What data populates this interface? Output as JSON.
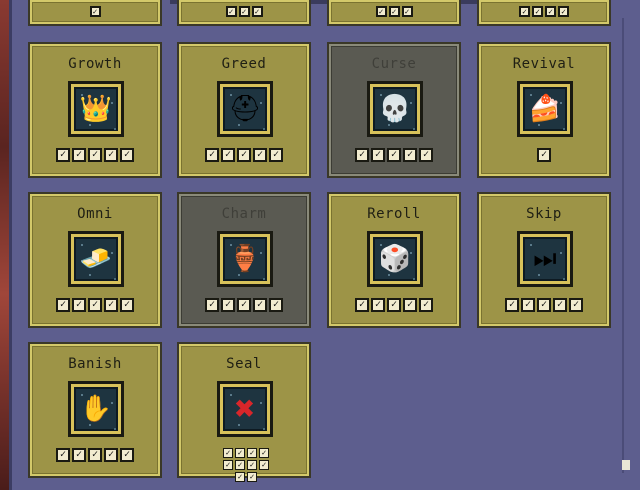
{
  "top_row": [
    {
      "checks": 1
    },
    {
      "checks": 3
    },
    {
      "checks": 3
    },
    {
      "checks": 4
    }
  ],
  "cards": [
    {
      "title": "Growth",
      "icon": "crown-icon",
      "glyph": "👑",
      "checks": 5,
      "dim": false
    },
    {
      "title": "Greed",
      "icon": "helmet-icon",
      "glyph": "⛑",
      "checks": 5,
      "dim": false
    },
    {
      "title": "Curse",
      "icon": "skull-icon",
      "glyph": "💀",
      "checks": 5,
      "dim": true
    },
    {
      "title": "Revival",
      "icon": "cake-icon",
      "glyph": "🍰",
      "checks": 1,
      "dim": false
    },
    {
      "title": "Omni",
      "icon": "gold-bar-icon",
      "glyph": "🧈",
      "checks": 5,
      "dim": false
    },
    {
      "title": "Charm",
      "icon": "potion-icon",
      "glyph": "🏺",
      "checks": 5,
      "dim": true
    },
    {
      "title": "Reroll",
      "icon": "dice-icon",
      "glyph": "🎲",
      "checks": 5,
      "dim": false
    },
    {
      "title": "Skip",
      "icon": "red-arrow-icon",
      "glyph": "⏭",
      "checks": 5,
      "dim": false
    },
    {
      "title": "Banish",
      "icon": "hand-icon",
      "glyph": "✋",
      "checks": 5,
      "dim": false
    },
    {
      "title": "Seal",
      "icon": "red-x-icon",
      "glyph": "✖",
      "checks": 10,
      "dim": false,
      "small_checks": true
    }
  ],
  "check_mark": "✓"
}
